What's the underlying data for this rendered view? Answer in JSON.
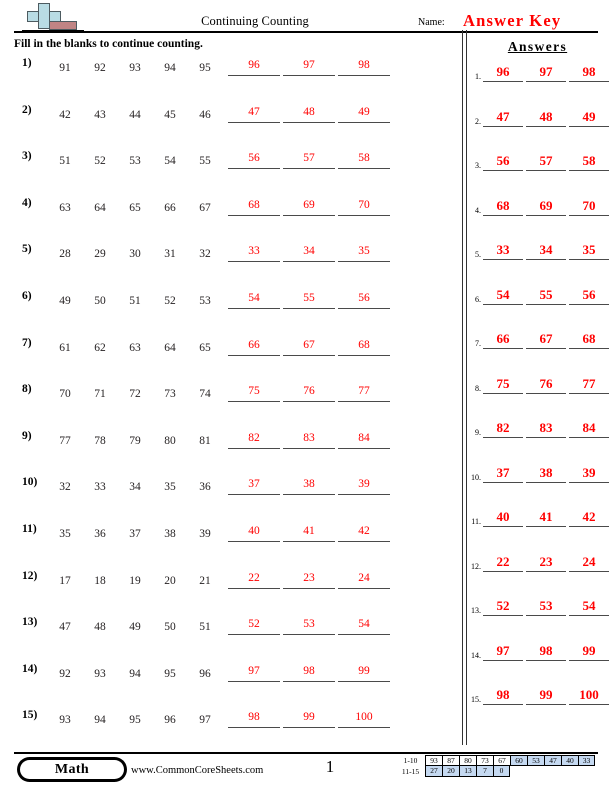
{
  "header": {
    "logo_name": "commoncoresheets-plus-logo",
    "title": "Continuing Counting",
    "name_label": "Name:",
    "answer_key": "Answer Key",
    "answer_key_color": "#ff0000",
    "instructions": "Fill in the blanks to continue counting."
  },
  "problems": [
    {
      "num": "1)",
      "given": [
        "91",
        "92",
        "93",
        "94",
        "95"
      ],
      "answers": [
        "96",
        "97",
        "98"
      ]
    },
    {
      "num": "2)",
      "given": [
        "42",
        "43",
        "44",
        "45",
        "46"
      ],
      "answers": [
        "47",
        "48",
        "49"
      ]
    },
    {
      "num": "3)",
      "given": [
        "51",
        "52",
        "53",
        "54",
        "55"
      ],
      "answers": [
        "56",
        "57",
        "58"
      ]
    },
    {
      "num": "4)",
      "given": [
        "63",
        "64",
        "65",
        "66",
        "67"
      ],
      "answers": [
        "68",
        "69",
        "70"
      ]
    },
    {
      "num": "5)",
      "given": [
        "28",
        "29",
        "30",
        "31",
        "32"
      ],
      "answers": [
        "33",
        "34",
        "35"
      ]
    },
    {
      "num": "6)",
      "given": [
        "49",
        "50",
        "51",
        "52",
        "53"
      ],
      "answers": [
        "54",
        "55",
        "56"
      ]
    },
    {
      "num": "7)",
      "given": [
        "61",
        "62",
        "63",
        "64",
        "65"
      ],
      "answers": [
        "66",
        "67",
        "68"
      ]
    },
    {
      "num": "8)",
      "given": [
        "70",
        "71",
        "72",
        "73",
        "74"
      ],
      "answers": [
        "75",
        "76",
        "77"
      ]
    },
    {
      "num": "9)",
      "given": [
        "77",
        "78",
        "79",
        "80",
        "81"
      ],
      "answers": [
        "82",
        "83",
        "84"
      ]
    },
    {
      "num": "10)",
      "given": [
        "32",
        "33",
        "34",
        "35",
        "36"
      ],
      "answers": [
        "37",
        "38",
        "39"
      ]
    },
    {
      "num": "11)",
      "given": [
        "35",
        "36",
        "37",
        "38",
        "39"
      ],
      "answers": [
        "40",
        "41",
        "42"
      ]
    },
    {
      "num": "12)",
      "given": [
        "17",
        "18",
        "19",
        "20",
        "21"
      ],
      "answers": [
        "22",
        "23",
        "24"
      ]
    },
    {
      "num": "13)",
      "given": [
        "47",
        "48",
        "49",
        "50",
        "51"
      ],
      "answers": [
        "52",
        "53",
        "54"
      ]
    },
    {
      "num": "14)",
      "given": [
        "92",
        "93",
        "94",
        "95",
        "96"
      ],
      "answers": [
        "97",
        "98",
        "99"
      ]
    },
    {
      "num": "15)",
      "given": [
        "93",
        "94",
        "95",
        "96",
        "97"
      ],
      "answers": [
        "98",
        "99",
        "100"
      ]
    }
  ],
  "answer_column": {
    "heading": "Answers",
    "rows": [
      {
        "num": "1.",
        "values": [
          "96",
          "97",
          "98"
        ]
      },
      {
        "num": "2.",
        "values": [
          "47",
          "48",
          "49"
        ]
      },
      {
        "num": "3.",
        "values": [
          "56",
          "57",
          "58"
        ]
      },
      {
        "num": "4.",
        "values": [
          "68",
          "69",
          "70"
        ]
      },
      {
        "num": "5.",
        "values": [
          "33",
          "34",
          "35"
        ]
      },
      {
        "num": "6.",
        "values": [
          "54",
          "55",
          "56"
        ]
      },
      {
        "num": "7.",
        "values": [
          "66",
          "67",
          "68"
        ]
      },
      {
        "num": "8.",
        "values": [
          "75",
          "76",
          "77"
        ]
      },
      {
        "num": "9.",
        "values": [
          "82",
          "83",
          "84"
        ]
      },
      {
        "num": "10.",
        "values": [
          "37",
          "38",
          "39"
        ]
      },
      {
        "num": "11.",
        "values": [
          "40",
          "41",
          "42"
        ]
      },
      {
        "num": "12.",
        "values": [
          "22",
          "23",
          "24"
        ]
      },
      {
        "num": "13.",
        "values": [
          "52",
          "53",
          "54"
        ]
      },
      {
        "num": "14.",
        "values": [
          "97",
          "98",
          "99"
        ]
      },
      {
        "num": "15.",
        "values": [
          "98",
          "99",
          "100"
        ]
      }
    ]
  },
  "footer": {
    "subject_badge": "Math",
    "website": "www.CommonCoreSheets.com",
    "page_number": "1",
    "scale": {
      "row1_label": "1-10",
      "row1_values": [
        "93",
        "87",
        "80",
        "73",
        "67",
        "60",
        "53",
        "47",
        "40",
        "33"
      ],
      "row1_highlight_from": 5,
      "row2_label": "11-15",
      "row2_values": [
        "27",
        "20",
        "13",
        "7",
        "0"
      ],
      "row2_highlight_from": 0,
      "highlight_color": "#c5d9f1"
    }
  }
}
